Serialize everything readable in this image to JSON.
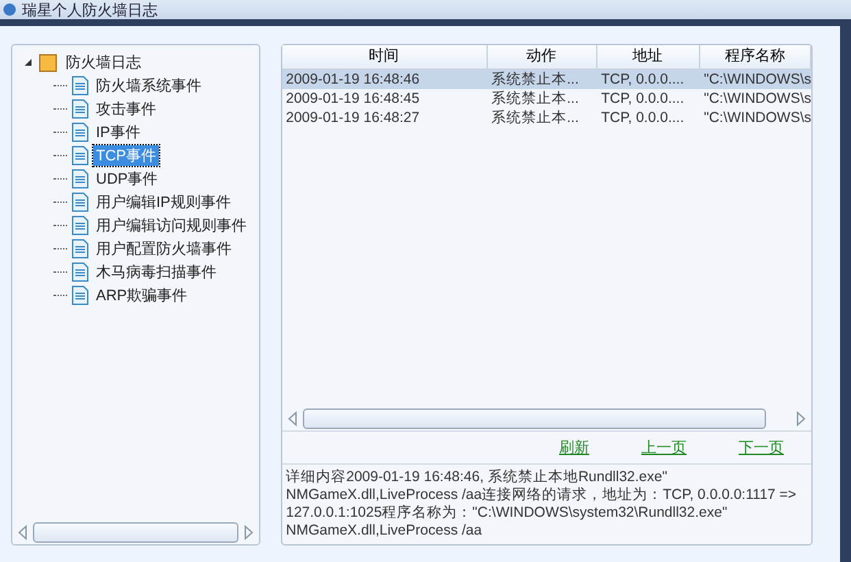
{
  "window": {
    "title": "瑞星个人防火墙日志"
  },
  "tree": {
    "label": "防火墙日志",
    "expanded": true,
    "children": [
      {
        "label": "防火墙系统事件",
        "selected": false
      },
      {
        "label": "攻击事件",
        "selected": false
      },
      {
        "label": "IP事件",
        "selected": false
      },
      {
        "label": "TCP事件",
        "selected": true
      },
      {
        "label": "UDP事件",
        "selected": false
      },
      {
        "label": "用户编辑IP规则事件",
        "selected": false
      },
      {
        "label": "用户编辑访问规则事件",
        "selected": false
      },
      {
        "label": "用户配置防火墙事件",
        "selected": false
      },
      {
        "label": "木马病毒扫描事件",
        "selected": false
      },
      {
        "label": "ARP欺骗事件",
        "selected": false
      }
    ]
  },
  "table": {
    "columns": [
      "时间",
      "动作",
      "地址",
      "程序名称"
    ],
    "rows": [
      {
        "cells": [
          "2009-01-19 16:48:46",
          "系统禁止本...",
          "TCP, 0.0.0....",
          "\"C:\\WINDOWS\\s"
        ],
        "selected": true
      },
      {
        "cells": [
          "2009-01-19 16:48:45",
          "系统禁止本...",
          "TCP, 0.0.0....",
          "\"C:\\WINDOWS\\s"
        ],
        "selected": false
      },
      {
        "cells": [
          "2009-01-19 16:48:27",
          "系统禁止本...",
          "TCP, 0.0.0....",
          "\"C:\\WINDOWS\\s"
        ],
        "selected": false
      }
    ]
  },
  "links": [
    "刷新",
    "上一页",
    "下一页"
  ],
  "detail": "详细内容2009-01-19 16:48:46, 系统禁止本地Rundll32.exe\" NMGameX.dll,LiveProcess /aa连接网络的请求，地址为：TCP, 0.0.0.0:1117 => 127.0.0.1:1025程序名称为：\"C:\\WINDOWS\\system32\\Rundll32.exe\" NMGameX.dll,LiveProcess /aa"
}
